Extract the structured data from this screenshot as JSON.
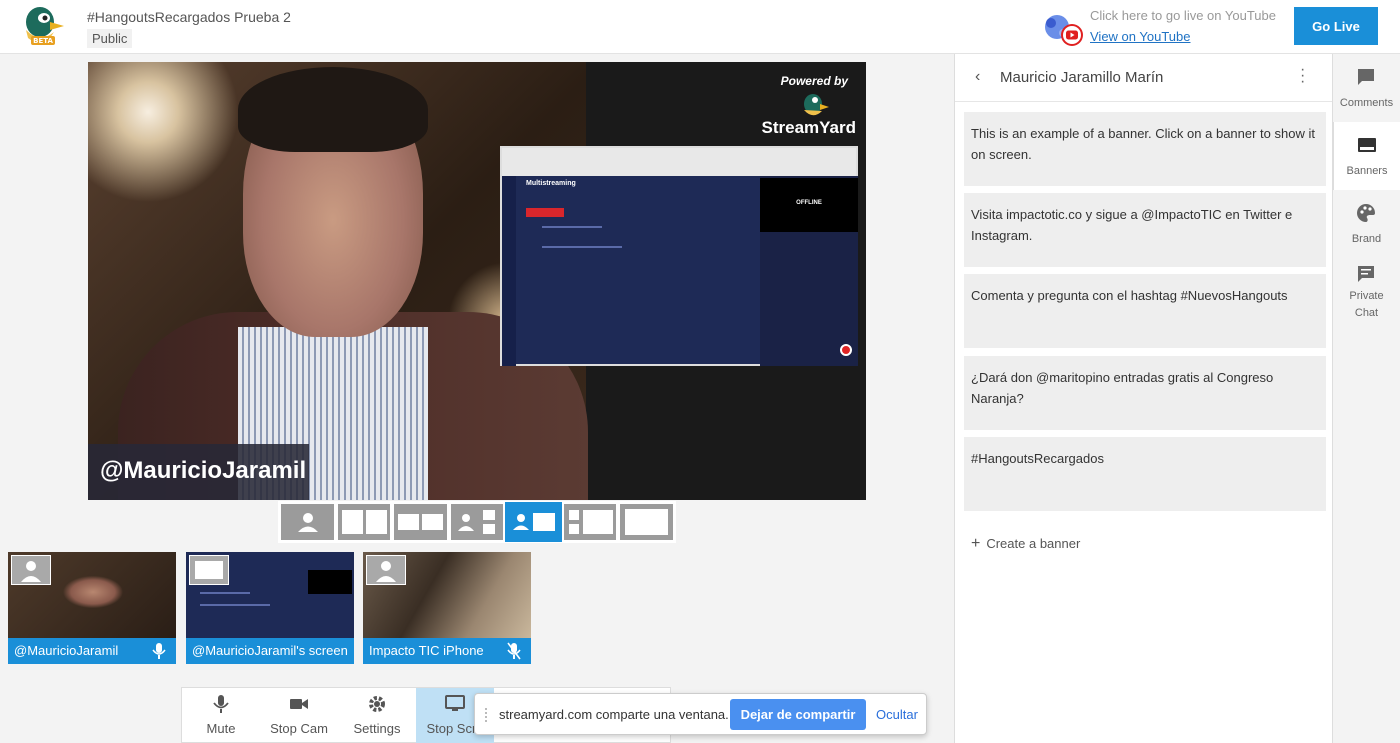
{
  "header": {
    "title": "#HangoutsRecargados Prueba 2",
    "visibility": "Public",
    "live_hint": "Click here to go live on YouTube",
    "view_link": "View on YouTube",
    "go_live": "Go Live",
    "logo_badge": "BETA"
  },
  "stage": {
    "powered_by": "Powered by",
    "brand": "StreamYard",
    "nameplate": "@MauricioJaramil",
    "share_title": "Multistreaming",
    "share_status": "OFFLINE"
  },
  "layouts": [
    "solo",
    "two-split",
    "two-split-small",
    "sidebar-stack",
    "picture-screen",
    "screen-stack",
    "screen-only"
  ],
  "thumbnails": [
    {
      "label": "@MauricioJaramil",
      "mic": "mic-icon"
    },
    {
      "label": "@MauricioJaramil's screen",
      "mic": ""
    },
    {
      "label": "Impacto TIC iPhone",
      "mic": "mic-off-icon"
    }
  ],
  "controls": {
    "mute": "Mute",
    "stop_cam": "Stop Cam",
    "settings": "Settings",
    "stop_screen": "Stop Scre"
  },
  "share_bubble": {
    "text": "streamyard.com comparte una ventana.",
    "stop": "Dejar de compartir",
    "hide": "Ocultar"
  },
  "panel": {
    "title": "Mauricio Jaramillo Marín",
    "banners": [
      "This is an example of a banner. Click on a banner to show it on screen.",
      "Visita impactotic.co y sigue a @ImpactoTIC en Twitter e Instagram.",
      "Comenta y pregunta con el hashtag #NuevosHangouts",
      "¿Dará don @maritopino entradas gratis al Congreso Naranja?",
      "#HangoutsRecargados"
    ],
    "create": "Create a banner"
  },
  "rail": {
    "comments": "Comments",
    "banners": "Banners",
    "brand": "Brand",
    "private_chat": "Private Chat"
  },
  "colors": {
    "accent": "#1a8fd8",
    "golive": "#1a8fd8",
    "nameplate_bg": "#28283a",
    "share_button": "#4a90f0"
  }
}
